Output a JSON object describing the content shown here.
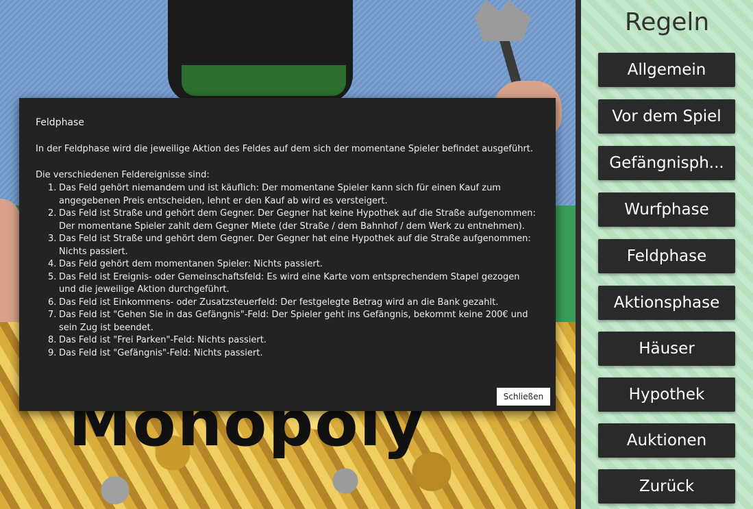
{
  "sidebar": {
    "title": "Regeln",
    "items": [
      {
        "label": "Allgemein"
      },
      {
        "label": "Vor dem Spiel"
      },
      {
        "label": "Gefängnisph..."
      },
      {
        "label": "Wurfphase"
      },
      {
        "label": "Feldphase"
      },
      {
        "label": "Aktionsphase"
      },
      {
        "label": "Häuser"
      },
      {
        "label": "Hypothek"
      },
      {
        "label": "Auktionen"
      },
      {
        "label": "Zurück"
      }
    ]
  },
  "background": {
    "logo_text": "Monopoly"
  },
  "modal": {
    "title": "Feldphase",
    "intro": "In der Feldphase wird die jeweilige Aktion des Feldes auf dem sich der momentane Spieler befindet ausgeführt.",
    "list_label": "Die verschiedenen Feldereignisse sind:",
    "items": [
      {
        "num": "1.",
        "line1": "Das Feld gehört niemandem und ist käuflich: Der momentane Spieler kann sich für einen Kauf zum",
        "line2": "angegebenen Preis entscheiden, lehnt er den Kauf ab wird es versteigert."
      },
      {
        "num": "2.",
        "line1": "Das Feld ist Straße und gehört dem Gegner. Der Gegner hat keine Hypothek auf die Straße aufgenommen:",
        "line2": "Der momentane Spieler zahlt dem Gegner Miete (der Straße / dem Bahnhof / dem Werk zu entnehmen)."
      },
      {
        "num": "3.",
        "line1": "Das Feld ist Straße und gehört dem Gegner. Der Gegner hat eine Hypothek auf die Straße aufgenommen:",
        "line2": "Nichts passiert."
      },
      {
        "num": "4.",
        "line1": "Das Feld gehört dem momentanen Spieler: Nichts passiert.",
        "line2": ""
      },
      {
        "num": "5.",
        "line1": "Das Feld ist Ereignis- oder Gemeinschaftsfeld: Es wird eine Karte vom entsprechendem Stapel gezogen",
        "line2": "und die jeweilige Aktion durchgeführt."
      },
      {
        "num": "6.",
        "line1": "Das Feld ist Einkommens- oder Zusatzsteuerfeld: Der festgelegte Betrag wird an die Bank gezahlt.",
        "line2": ""
      },
      {
        "num": "7.",
        "line1": "Das Feld ist \"Gehen Sie in das Gefängnis\"-Feld: Der Spieler geht ins Gefängnis, bekommt keine 200€ und",
        "line2": "sein Zug ist beendet."
      },
      {
        "num": "8.",
        "line1": "Das Feld ist \"Frei Parken\"-Feld: Nichts passiert.",
        "line2": ""
      },
      {
        "num": "9.",
        "line1": "Das Feld ist \"Gefängnis\"-Feld: Nichts passiert.",
        "line2": ""
      }
    ],
    "close_label": "Schließen"
  }
}
